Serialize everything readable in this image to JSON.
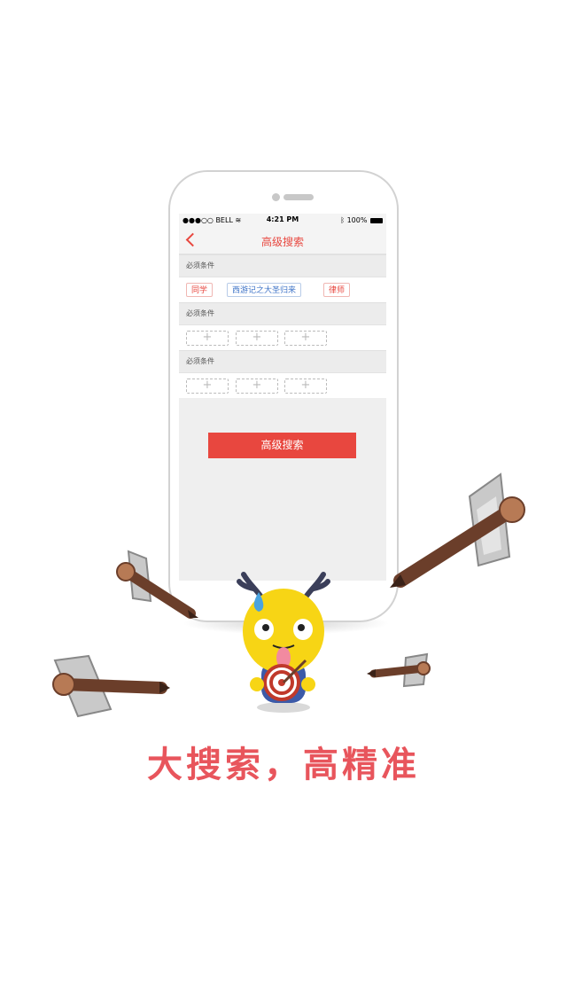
{
  "status_bar": {
    "carrier": "●●●○○ BELL",
    "time": "4:21 PM",
    "battery": "100%"
  },
  "nav": {
    "title": "高级搜索"
  },
  "sections": [
    {
      "header": "必须条件",
      "chips": [
        "同学",
        "西游记之大圣归来",
        "律师"
      ]
    },
    {
      "header": "必须条件",
      "add_slots": [
        "+",
        "+",
        "+"
      ]
    },
    {
      "header": "必须条件",
      "add_slots": [
        "+",
        "+",
        "+"
      ]
    }
  ],
  "search_button": "高级搜索",
  "slogan": "大搜索，高精准",
  "colors": {
    "accent": "#e8473f",
    "chip_blue": "#3f74c7",
    "mascot_yellow": "#f7d515",
    "arrow_wood": "#6b3e2a"
  },
  "icons": [
    "back-chevron-icon",
    "wifi-icon",
    "bluetooth-icon",
    "battery-icon",
    "plus-icon"
  ]
}
